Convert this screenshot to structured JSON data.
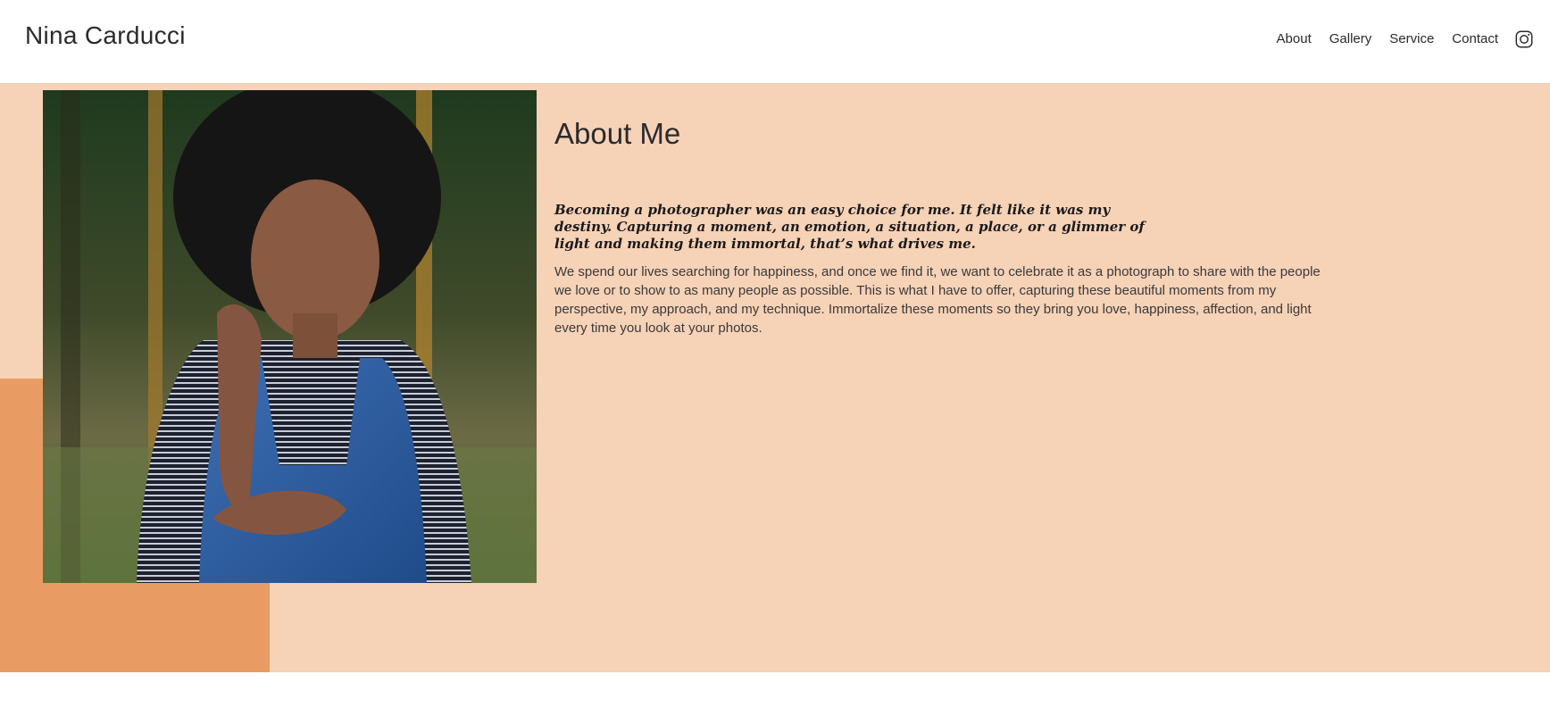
{
  "header": {
    "site_title": "Nina Carducci",
    "nav": {
      "items": [
        "About",
        "Gallery",
        "Service",
        "Contact"
      ]
    },
    "social_icon": "instagram-icon"
  },
  "about": {
    "heading": "About Me",
    "quote": "Becoming a photographer was an easy choice for me. It felt like it was my destiny. Capturing a moment, an emotion, a situation, a place, or a glimmer of light and making them immortal, that’s what drives me.",
    "body": "We spend our lives searching for happiness, and once we find it, we want to celebrate it as a photograph to share with the people we love or to show to as many people as possible. This is what I have to offer, capturing these beautiful moments from my perspective, my approach, and my technique. Immortalize these moments so they bring you love, happiness, affection, and light every time you look at your photos."
  },
  "colors": {
    "band_background": "#f6d2b7",
    "accent_block": "#e89c63",
    "text": "#2b2b2b"
  }
}
